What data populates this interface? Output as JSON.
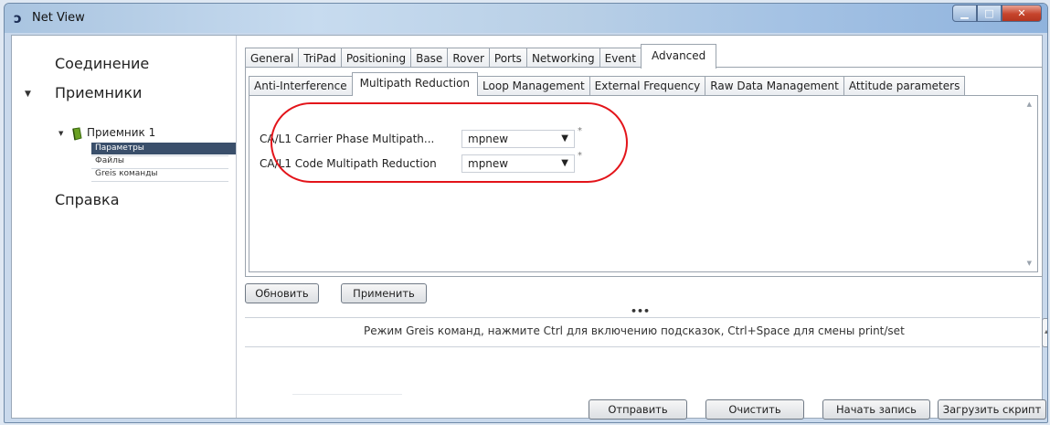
{
  "window": {
    "title": "Net View",
    "app_icon": "ↄ"
  },
  "nav": {
    "connection": "Соединение",
    "receivers": "Приемники",
    "receiver1": "Приемник 1",
    "children": [
      "Параметры",
      "Файлы",
      "Greis команды"
    ],
    "help": "Справка"
  },
  "tabs": [
    "General",
    "TriPad",
    "Positioning",
    "Base",
    "Rover",
    "Ports",
    "Networking",
    "Event",
    "Advanced"
  ],
  "active_tab": "Advanced",
  "subtabs": [
    "Anti-Interference",
    "Multipath Reduction",
    "Loop Management",
    "External Frequency",
    "Raw Data Management",
    "Attitude parameters"
  ],
  "active_subtab": "Multipath Reduction",
  "settings": {
    "row1": {
      "label": "CA/L1 Carrier Phase Multipath...",
      "value": "mpnew",
      "marker": "*"
    },
    "row2": {
      "label": "CA/L1 Code Multipath Reduction",
      "value": "mpnew",
      "marker": "*"
    }
  },
  "buttons": {
    "refresh": "Обновить",
    "apply": "Применить",
    "send": "Отправить",
    "clear": "Очистить",
    "start_record": "Начать запись",
    "load_script": "Загрузить скрипт"
  },
  "console": {
    "hint": "Режим Greis команд, нажмите  Ctrl для включению подсказок, Ctrl+Space для смены print/set",
    "splitter": "•••"
  },
  "colors": {
    "highlight_oval": "#e3141a",
    "selected_nav": "#3a4f6b",
    "close_button": "#c6442c"
  }
}
